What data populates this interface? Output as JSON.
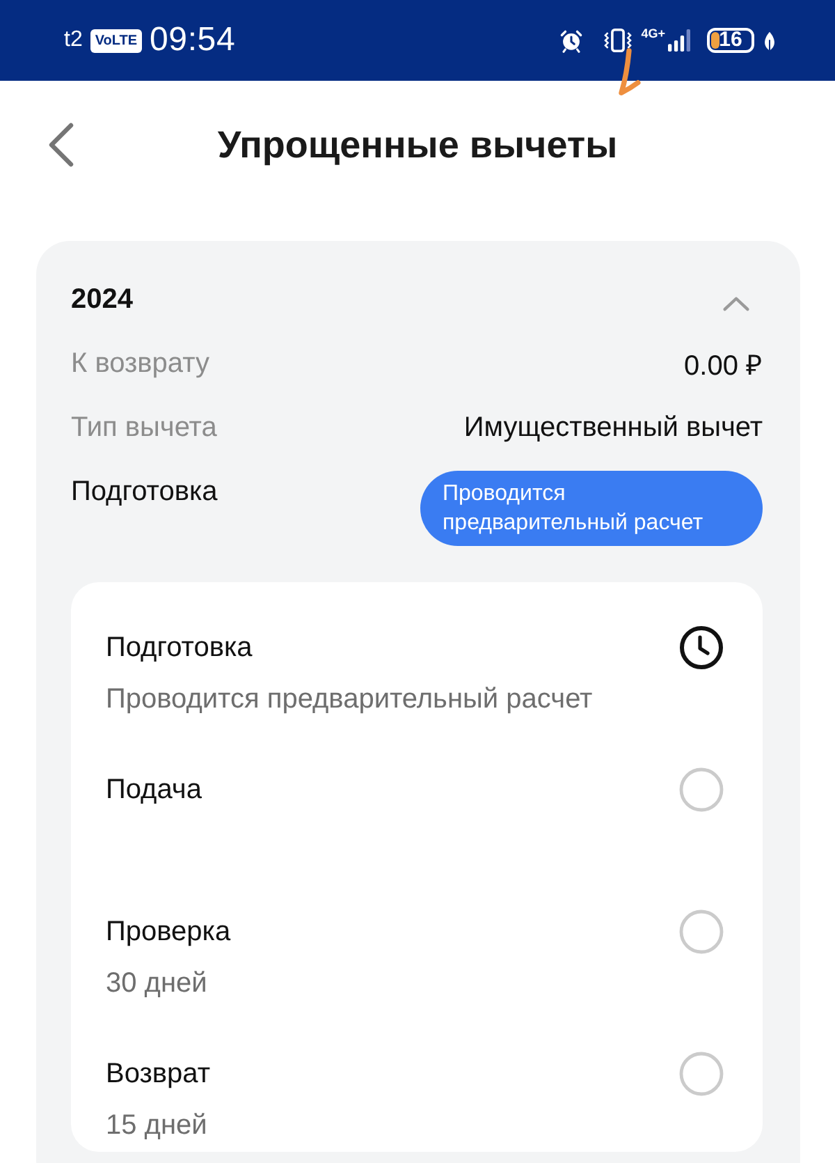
{
  "status_bar": {
    "carrier": "t2",
    "volte": "VoLTE",
    "time": "09:54",
    "network": "4G+",
    "battery": "16"
  },
  "header": {
    "title": "Упрощенные вычеты"
  },
  "card": {
    "year": "2024",
    "expanded": true,
    "rows": [
      {
        "label": "К возврату",
        "value": "0.00 ₽"
      },
      {
        "label": "Тип вычета",
        "value": "Имущественный вычет"
      }
    ],
    "stage": {
      "label": "Подготовка",
      "badge": "Проводится предварительный расчет"
    },
    "steps": [
      {
        "title": "Подготовка",
        "subtitle": "Проводится предварительный расчет",
        "active": true
      },
      {
        "title": "Подача",
        "active": false
      },
      {
        "title": "Проверка",
        "subtitle": "30 дней",
        "active": false
      },
      {
        "title": "Возврат",
        "subtitle": "15 дней",
        "active": false
      }
    ]
  }
}
